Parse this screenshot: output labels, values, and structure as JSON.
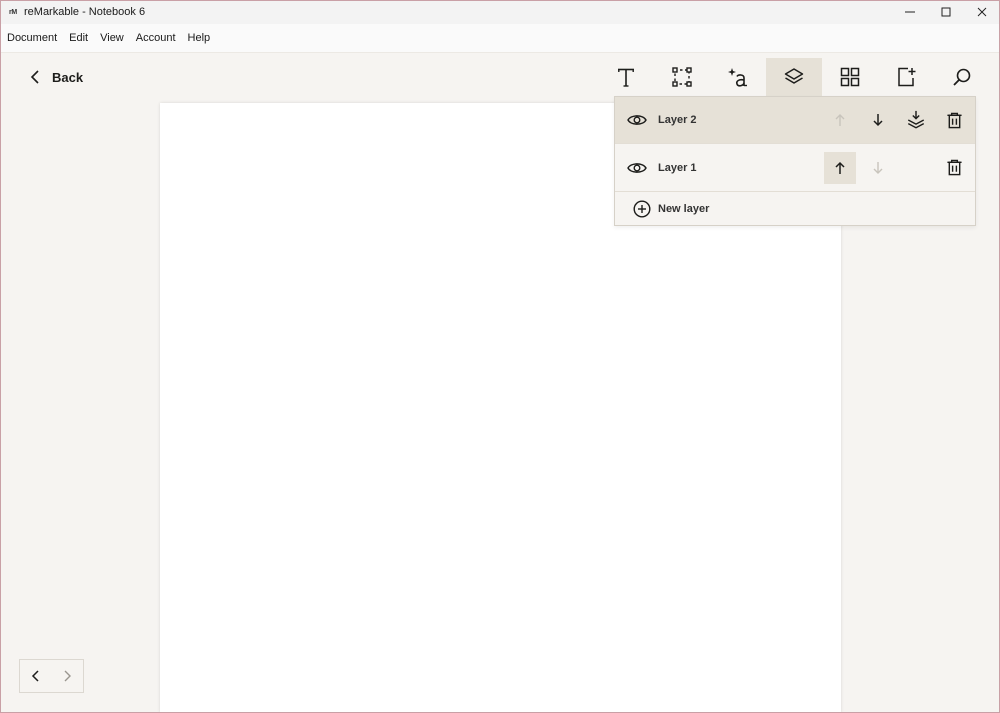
{
  "window": {
    "logo": "rM",
    "title": "reMarkable - Notebook 6"
  },
  "menubar": {
    "items": [
      "Document",
      "Edit",
      "View",
      "Account",
      "Help"
    ]
  },
  "toolbar": {
    "back_label": "Back",
    "tools": [
      "text-icon",
      "selection-icon",
      "ai-handwriting-icon",
      "layers-icon",
      "grid-icon",
      "add-page-icon",
      "search-icon"
    ],
    "active_tool": "layers-icon"
  },
  "layers": {
    "items": [
      {
        "name": "Layer 2",
        "selected": true
      },
      {
        "name": "Layer 1",
        "selected": false
      }
    ],
    "new_layer_label": "New layer"
  },
  "colors": {
    "background": "#f6f4f1",
    "active": "#e6e1d7",
    "page": "#ffffff"
  }
}
